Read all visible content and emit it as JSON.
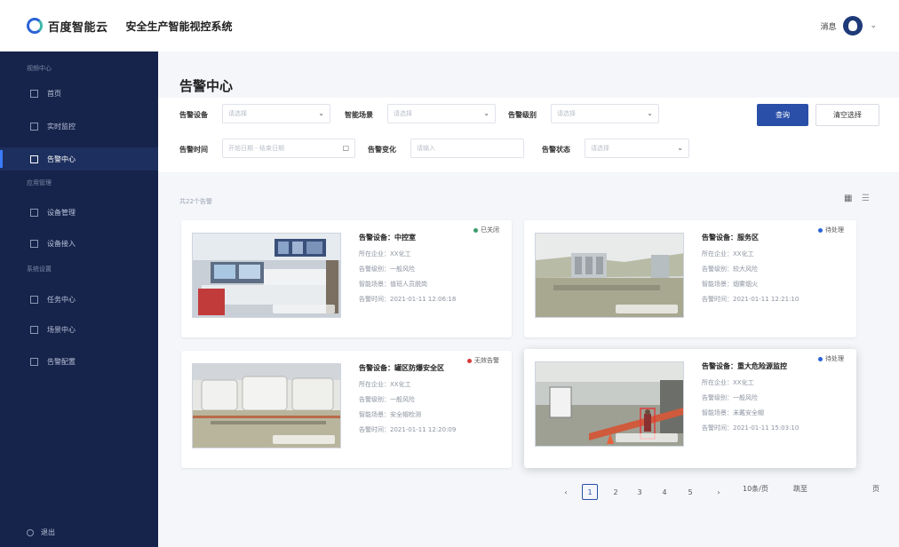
{
  "header": {
    "brand": "百度智能云",
    "system_title": "安全生产智能视控系统",
    "message": "消息"
  },
  "sidebar": {
    "sections": [
      "视频中心",
      "应用管理",
      "系统设置"
    ],
    "items": [
      {
        "label": "首页"
      },
      {
        "label": "实时监控"
      },
      {
        "label": "告警中心",
        "active": true
      },
      {
        "label": "设备管理"
      },
      {
        "label": "设备接入"
      },
      {
        "label": "任务中心"
      },
      {
        "label": "场景中心"
      },
      {
        "label": "告警配置"
      }
    ],
    "logout": "退出"
  },
  "main": {
    "title": "告警中心",
    "filters": {
      "device_label": "告警设备",
      "device_placeholder": "请选择",
      "scene_label": "智能场景",
      "scene_placeholder": "请选择",
      "level_label": "告警级别",
      "level_placeholder": "请选择",
      "time_label": "告警时间",
      "time_placeholder": "开始日期 - 结束日期",
      "change_label": "告警变化",
      "change_placeholder": "请输入",
      "status_label": "告警状态",
      "status_placeholder": "请选择",
      "search_button": "查询",
      "reset_button": "清空选择"
    },
    "result_text": "共22个告警"
  },
  "alarms": [
    {
      "device": "告警设备：中控室",
      "company": "所在企业：XX化工",
      "level": "告警级别：一般风险",
      "scene": "智能场景：值班人员脱岗",
      "time": "告警时间：2021-01-11 12:06:18",
      "status": "已关闭",
      "status_color": "#3b9b6c"
    },
    {
      "device": "告警设备：服务区",
      "company": "所在企业：XX化工",
      "level": "告警级别：较大风险",
      "scene": "智能场景：烟雾烟火",
      "time": "告警时间：2021-01-11 12:21:10",
      "status": "待处理",
      "status_color": "#2a63d6"
    },
    {
      "device": "告警设备：罐区防爆安全区",
      "company": "所在企业：XX化工",
      "level": "告警级别：一般风险",
      "scene": "智能场景：安全帽检测",
      "time": "告警时间：2021-01-11 12:20:09",
      "status": "无效告警",
      "status_color": "#d83a3a"
    },
    {
      "device": "告警设备：重大危险源监控",
      "company": "所在企业：XX化工",
      "level": "告警级别：一般风险",
      "scene": "智能场景：未戴安全帽",
      "time": "告警时间：2021-01-11 15:03:10",
      "status": "待处理",
      "status_color": "#2a63d6"
    }
  ],
  "pagination": {
    "prev": "‹",
    "pages": [
      "1",
      "2",
      "3",
      "4",
      "5"
    ],
    "next": "›",
    "page_size": "10条/页",
    "jump": "跳至",
    "unit": "页"
  }
}
